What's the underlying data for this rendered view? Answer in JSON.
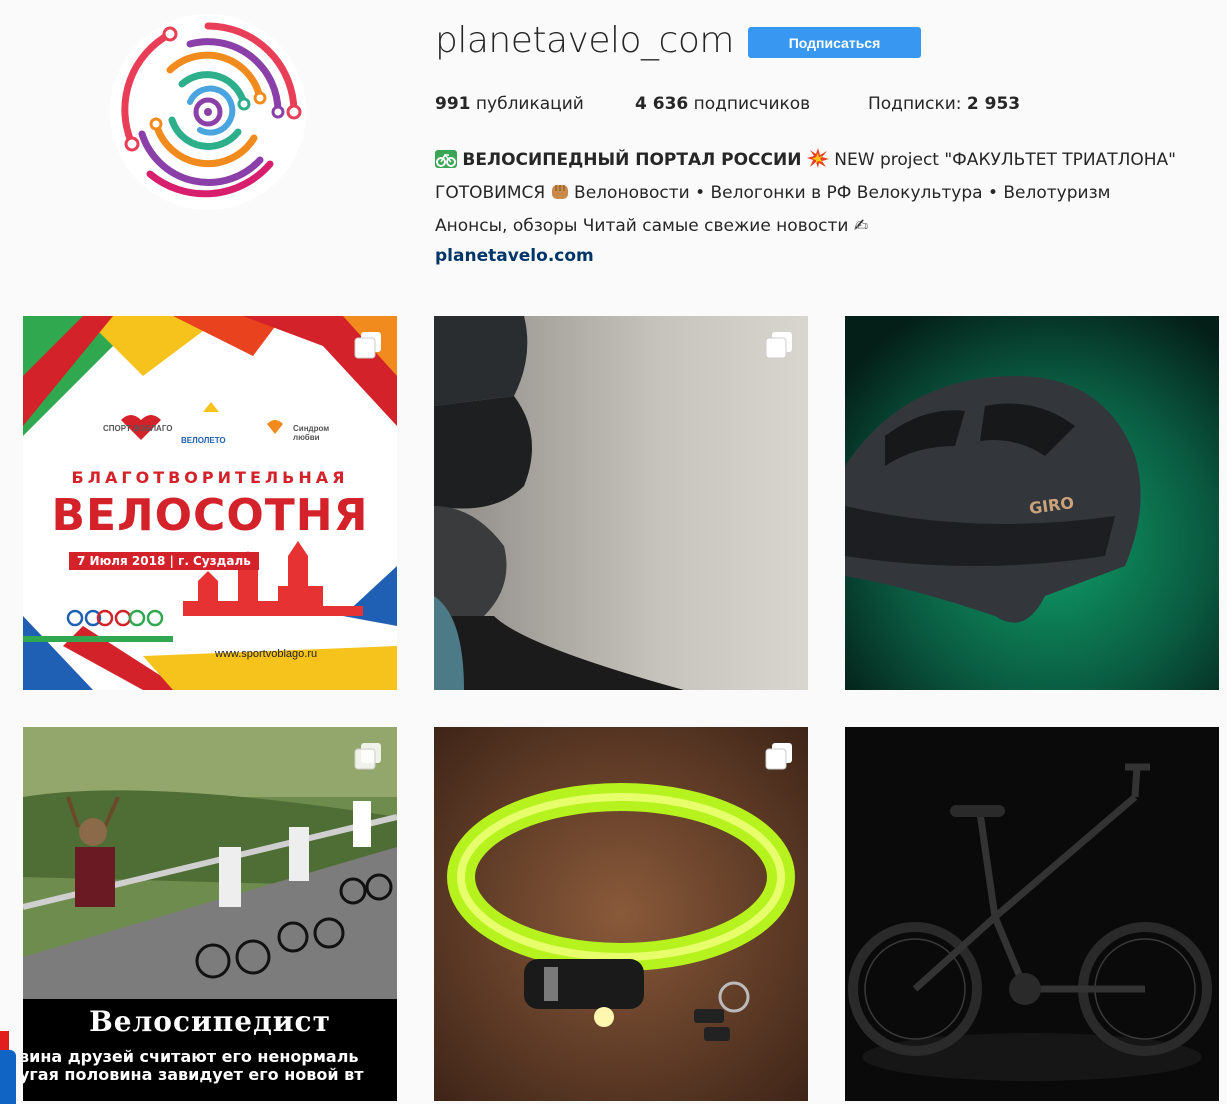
{
  "profile": {
    "username": "planetavelo_com",
    "follow_label": "Подписаться",
    "stats": {
      "posts_count": "991",
      "posts_label": " публикаций",
      "followers_count": "4 636",
      "followers_label": " подписчиков",
      "following_label": "Подписки: ",
      "following_count": "2 953"
    },
    "bio": {
      "title": "ВЕЛОСИПЕДНЫЙ ПОРТАЛ РОССИИ",
      "line1_tail": " NEW project \"ФАКУЛЬТЕТ ТРИАТЛОНА\"",
      "line2_a": "ГОТОВИМСЯ ",
      "line2_b": " Велоновости • Велогонки в РФ Велокультура • Велотуризм",
      "line3": "Анонсы, обзоры    Читай самые свежие новости ",
      "line3_icon": "✍",
      "link": "planetavelo.com"
    }
  },
  "posts": [
    {
      "kind": "charity-poster",
      "multi": true,
      "logo1": "СПОРТ ВОБЛАГО",
      "logo2": "ВЕЛОЛЕТО",
      "logo3": "Синдром любви",
      "subtitle": "БЛАГОТВОРИТЕЛЬНАЯ",
      "title": "ВЕЛОСОТНЯ",
      "date": "7 Июля 2018 | г. Суздаль",
      "url": "www.sportvoblago.ru"
    },
    {
      "kind": "cyclist-closeup",
      "multi": true
    },
    {
      "kind": "helmet",
      "multi": false,
      "brand": "GIRO"
    },
    {
      "kind": "meme",
      "multi": true,
      "caption_title": "Велосипедист",
      "caption_line1": "вина друзей считают его ненормаль",
      "caption_line2": "угая половина завидует его новой вт"
    },
    {
      "kind": "bike-lock",
      "multi": true
    },
    {
      "kind": "folding-bike",
      "multi": false
    }
  ],
  "colors": {
    "button": "#3897f0",
    "link": "#003569",
    "poster_red": "#d32229"
  }
}
